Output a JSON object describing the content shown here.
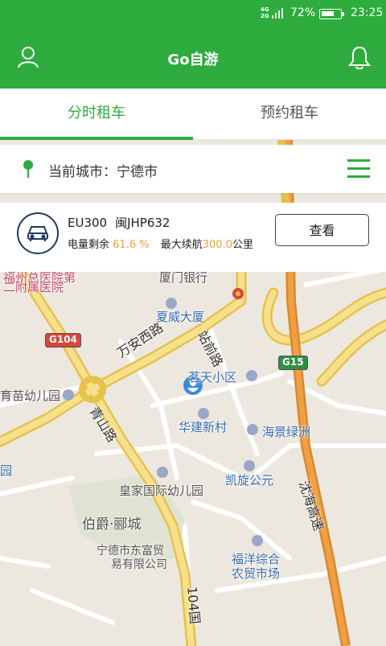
{
  "status_bar": {
    "network": "4G",
    "network2": "2G",
    "battery_pct": "72%",
    "battery_level": 0.72,
    "time": "23:25"
  },
  "header": {
    "title": "Go自游",
    "profile_icon": "user-icon",
    "notify_icon": "bell-icon"
  },
  "tabs": [
    {
      "label": "分时租车",
      "active": true
    },
    {
      "label": "预约租车",
      "active": false
    }
  ],
  "city": {
    "prefix": "当前城市：",
    "name": "宁德市"
  },
  "car": {
    "model": "EU300",
    "plate": "闽JHP632",
    "battery_label": "电量剩余",
    "battery_value": "61.6 %",
    "range_label": "最大续航",
    "range_value": "300.0",
    "range_unit": "公里",
    "view_button": "查看"
  },
  "map": {
    "labels": {
      "hospital1": "福州总医院第",
      "hospital2": "二附属医院",
      "bank": "厦门银行",
      "hotel": "夏威大厦",
      "road_wanan": "万安西路",
      "road_zhanqian": "站前路",
      "road_qingshan": "青山路",
      "community": "茗天小区",
      "kindergarten1": "育苗幼儿园",
      "huajian": "华建新村",
      "haijing": "海景绿洲",
      "kaixuan": "凯旋公元",
      "royal_kg": "皇家国际幼儿园",
      "bojue": "伯爵·郦城",
      "trade1": "宁德市东富贸",
      "trade2": "易有限公司",
      "market1": "福洋综合",
      "market2": "农贸市场",
      "expressway": "沈海高速",
      "g104_road": "104国",
      "edge_left": "园"
    },
    "shields": {
      "g104": "G104",
      "g15": "G15"
    }
  }
}
